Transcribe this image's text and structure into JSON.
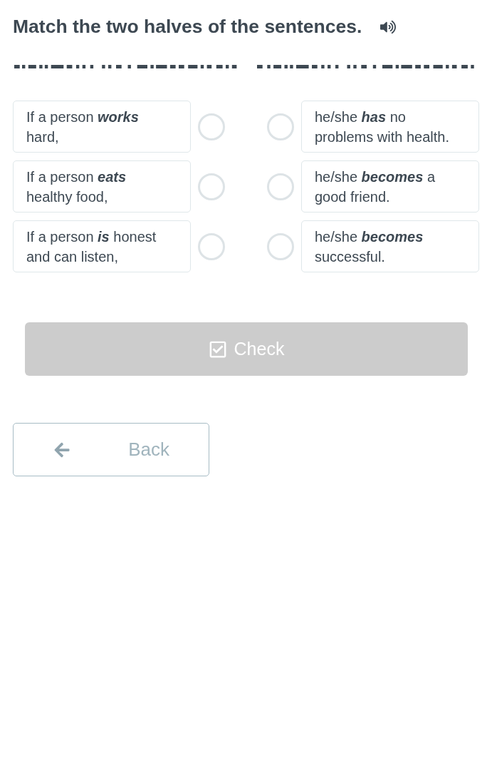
{
  "title": "Match the two halves of the sentences.",
  "left_halves": [
    {
      "text": "If a person **works** hard,",
      "selected": false
    },
    {
      "text": "If a person **eats** healthy food,",
      "selected": false
    },
    {
      "text": "If a person **is** honest and can listen,",
      "selected": false
    }
  ],
  "right_halves": [
    {
      "text": "he/she **has** no problems with health.",
      "selected": false
    },
    {
      "text": "he/she **becomes** a good friend.",
      "selected": false
    },
    {
      "text": "he/she **becomes** successful.",
      "selected": false
    }
  ],
  "check_button": {
    "label": "Check",
    "disabled": true
  },
  "back_button": {
    "label": "Back"
  }
}
